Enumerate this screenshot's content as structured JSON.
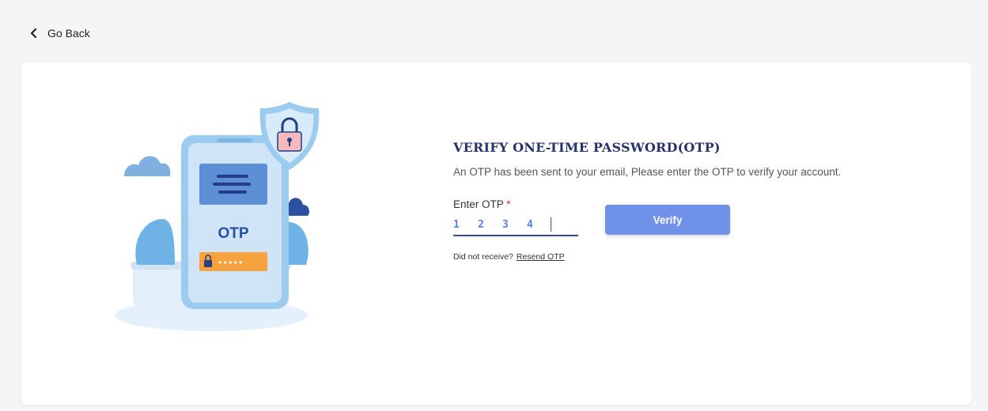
{
  "nav": {
    "go_back_label": "Go Back"
  },
  "otp": {
    "title": "VERIFY ONE-TIME PASSWORD(OTP)",
    "subtitle": "An OTP has been sent to your email, Please enter the OTP to verify your account.",
    "field_label": "Enter OTP",
    "required_mark": "*",
    "digits": [
      "1",
      "2",
      "3",
      "4"
    ],
    "verify_label": "Verify",
    "resend_prompt": "Did not receive?",
    "resend_link": "Resend OTP"
  },
  "illustration": {
    "otp_text": "OTP",
    "mask_text": "•••••"
  },
  "colors": {
    "accent": "#6f92e8",
    "title": "#27346a",
    "underline": "#3747a8",
    "required": "#e0245e"
  }
}
